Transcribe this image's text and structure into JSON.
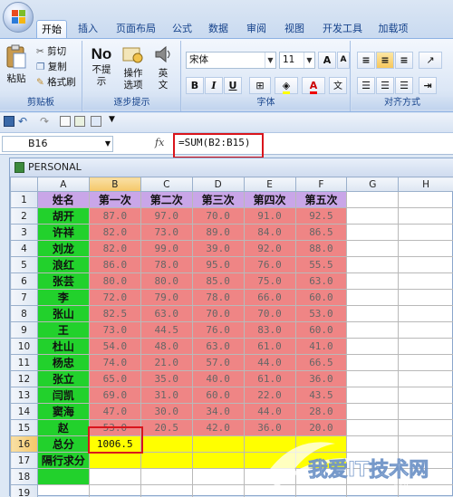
{
  "ribbon": {
    "tabs": [
      "开始",
      "插入",
      "页面布局",
      "公式",
      "数据",
      "审阅",
      "视图",
      "开发工具",
      "加载项"
    ],
    "active_tab": "开始",
    "clipboard": {
      "paste_label": "粘贴",
      "cut_label": "剪切",
      "copy_label": "复制",
      "format_painter_label": "格式刷",
      "group_label": "剪贴板"
    },
    "stepper": {
      "no_label": "No",
      "no_prompt_label": "不提示",
      "op_label": "操作选项",
      "en_label": "英文",
      "group_label": "逐步提示"
    },
    "font": {
      "name": "宋体",
      "size": "11",
      "group_label": "字体",
      "bold": "B",
      "italic": "I",
      "underline": "U",
      "grow": "A",
      "shrink": "A"
    },
    "align": {
      "group_label": "对齐方式"
    }
  },
  "formula_bar": {
    "name_box": "B16",
    "fx": "fx",
    "formula": "=SUM(B2:B15)"
  },
  "workbook": {
    "title": "PERSONAL"
  },
  "sheet": {
    "columns": [
      "A",
      "B",
      "C",
      "D",
      "E",
      "F",
      "G",
      "H"
    ],
    "headers": [
      "姓名",
      "第一次",
      "第二次",
      "第三次",
      "第四次",
      "第五次"
    ],
    "rows": [
      {
        "num": "2",
        "name": "胡开",
        "vals": [
          "87.0",
          "97.0",
          "70.0",
          "91.0",
          "92.5"
        ]
      },
      {
        "num": "3",
        "name": "许祥",
        "vals": [
          "82.0",
          "73.0",
          "89.0",
          "84.0",
          "86.5"
        ]
      },
      {
        "num": "4",
        "name": "刘龙",
        "vals": [
          "82.0",
          "99.0",
          "39.0",
          "92.0",
          "88.0"
        ]
      },
      {
        "num": "5",
        "name": "浪红",
        "vals": [
          "86.0",
          "78.0",
          "95.0",
          "76.0",
          "55.5"
        ]
      },
      {
        "num": "6",
        "name": "张芸",
        "vals": [
          "80.0",
          "80.0",
          "85.0",
          "75.0",
          "63.0"
        ]
      },
      {
        "num": "7",
        "name": "李",
        "vals": [
          "72.0",
          "79.0",
          "78.0",
          "66.0",
          "60.0"
        ]
      },
      {
        "num": "8",
        "name": "张山",
        "vals": [
          "82.5",
          "63.0",
          "70.0",
          "70.0",
          "53.0"
        ]
      },
      {
        "num": "9",
        "name": "王",
        "vals": [
          "73.0",
          "44.5",
          "76.0",
          "83.0",
          "60.0"
        ]
      },
      {
        "num": "10",
        "name": "杜山",
        "vals": [
          "54.0",
          "48.0",
          "63.0",
          "61.0",
          "41.0"
        ]
      },
      {
        "num": "11",
        "name": "杨忠",
        "vals": [
          "74.0",
          "21.0",
          "57.0",
          "44.0",
          "66.5"
        ]
      },
      {
        "num": "12",
        "name": "张立",
        "vals": [
          "65.0",
          "35.0",
          "40.0",
          "61.0",
          "36.0"
        ]
      },
      {
        "num": "13",
        "name": "闫凯",
        "vals": [
          "69.0",
          "31.0",
          "60.0",
          "22.0",
          "43.5"
        ]
      },
      {
        "num": "14",
        "name": "窦海",
        "vals": [
          "47.0",
          "30.0",
          "34.0",
          "44.0",
          "28.0"
        ]
      },
      {
        "num": "15",
        "name": "赵",
        "vals": [
          "53.0",
          "20.5",
          "42.0",
          "36.0",
          "20.0"
        ]
      }
    ],
    "total_label": "总分",
    "total_value": "1006.5",
    "alt_label": "隔行求分"
  },
  "watermark": {
    "text": "我爱IT技术网",
    "url": "www.52ij.com"
  },
  "colors": {
    "header": "#c9a6e8",
    "name": "#22d12c",
    "values": "#ef8585",
    "total": "#ffff00",
    "highlight": "#d9151c"
  }
}
